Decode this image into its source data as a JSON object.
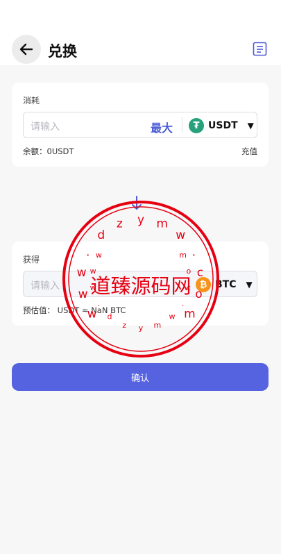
{
  "header": {
    "title": "兑换"
  },
  "from_card": {
    "label": "消耗",
    "placeholder": "请输入",
    "max_label": "最大",
    "coin": "USDT",
    "balance_text": "余额：0USDT",
    "recharge_label": "充值"
  },
  "to_card": {
    "label": "获得",
    "placeholder": "请输入",
    "coin": "BTC",
    "estimate_text": "预估值： USDT ≈ NaN BTC"
  },
  "confirm_label": "确认",
  "watermark": {
    "main_text": "道臻源码网",
    "ring_text": "www.dzymw.com"
  },
  "colors": {
    "accent": "#4b5bd6",
    "button": "#5563e0",
    "usdt": "#26a17b",
    "btc": "#f7931a",
    "stamp": "#e60012"
  }
}
